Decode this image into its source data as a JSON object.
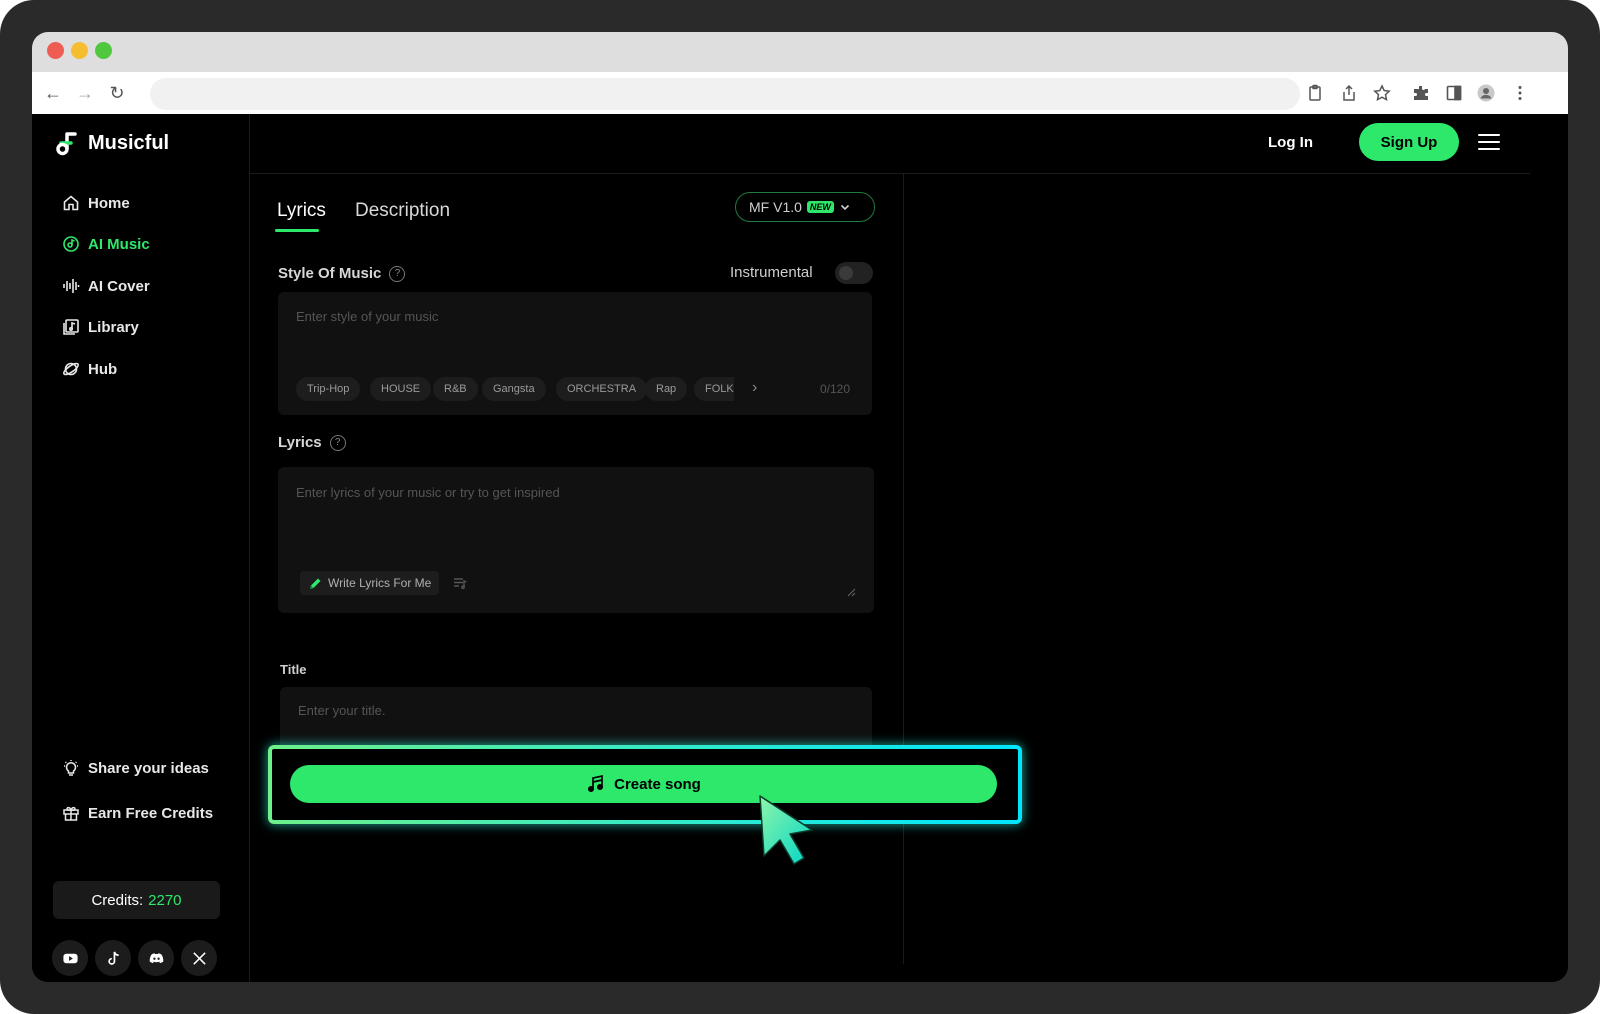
{
  "app": {
    "name": "Musicful"
  },
  "sidebar": {
    "items": [
      {
        "label": "Home",
        "icon": "home-icon"
      },
      {
        "label": "AI Music",
        "icon": "music-disc-icon",
        "active": true
      },
      {
        "label": "AI Cover",
        "icon": "waveform-icon"
      },
      {
        "label": "Library",
        "icon": "library-icon"
      },
      {
        "label": "Hub",
        "icon": "planet-icon"
      }
    ],
    "share_label": "Share your ideas",
    "earn_label": "Earn Free Credits",
    "credits_label": "Credits:",
    "credits_value": "2270",
    "socials": [
      "youtube-icon",
      "tiktok-icon",
      "discord-icon",
      "x-icon"
    ]
  },
  "header": {
    "login_label": "Log In",
    "signup_label": "Sign Up"
  },
  "main": {
    "tabs": [
      {
        "label": "Lyrics",
        "active": true
      },
      {
        "label": "Description",
        "active": false
      }
    ],
    "model": {
      "label": "MF V1.0",
      "badge": "NEW"
    },
    "style": {
      "label": "Style Of Music",
      "help": "?",
      "placeholder": "Enter style of your music",
      "chips": [
        "Trip-Hop",
        "HOUSE",
        "R&B",
        "Gangsta",
        "ORCHESTRA",
        "Rap",
        "FOLK"
      ],
      "counter": "0/120"
    },
    "instrumental": {
      "label": "Instrumental",
      "enabled": false
    },
    "lyrics": {
      "label": "Lyrics",
      "help": "?",
      "placeholder": "Enter lyrics of your music or try to get inspired",
      "write_label": "Write Lyrics For Me"
    },
    "title": {
      "label": "Title",
      "placeholder": "Enter your title."
    },
    "create_label": "Create song"
  },
  "colors": {
    "accent": "#2ee86c",
    "background": "#000000",
    "field": "#111111",
    "highlight_gradient": [
      "#6ef08a",
      "#00e5ff"
    ]
  }
}
